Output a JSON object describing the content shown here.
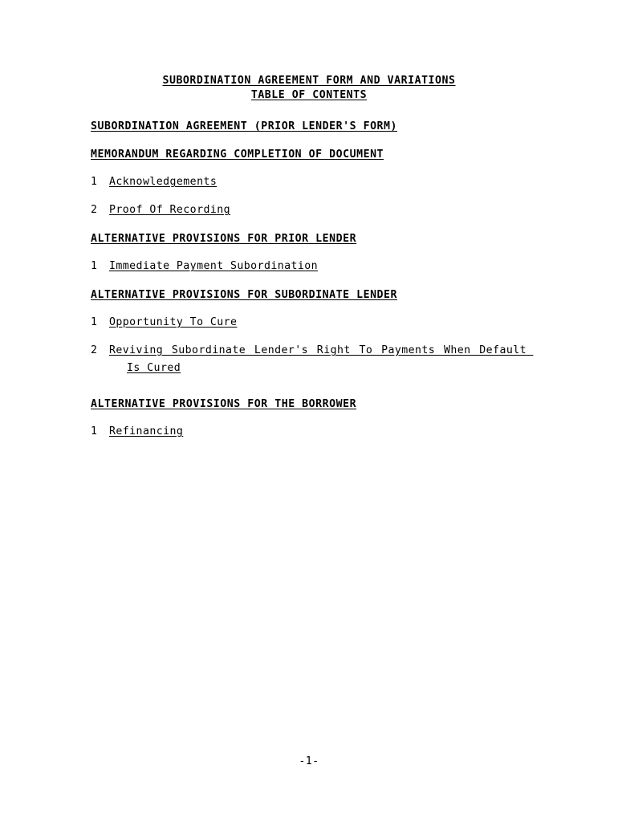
{
  "document": {
    "title_lines": [
      "SUBORDINATION AGREEMENT FORM AND VARIATIONS",
      "TABLE OF CONTENTS"
    ],
    "footer": "-1-"
  },
  "toc": {
    "sections": [
      {
        "heading": "SUBORDINATION AGREEMENT (PRIOR LENDER'S FORM)",
        "items": []
      },
      {
        "heading": "MEMORANDUM REGARDING COMPLETION OF DOCUMENT",
        "items": [
          {
            "number": "1",
            "label": "Acknowledgements"
          },
          {
            "number": "2",
            "label": "Proof Of Recording"
          }
        ]
      },
      {
        "heading": "ALTERNATIVE PROVISIONS FOR PRIOR LENDER",
        "items": [
          {
            "number": "1",
            "label": "Immediate Payment Subordination"
          }
        ]
      },
      {
        "heading": "ALTERNATIVE PROVISIONS FOR SUBORDINATE LENDER",
        "items": [
          {
            "number": "1",
            "label": "Opportunity To Cure"
          },
          {
            "number": "2",
            "label": "Reviving Subordinate Lender's Right To Payments When Default Is Cured"
          }
        ]
      },
      {
        "heading": "ALTERNATIVE PROVISIONS FOR THE BORROWER",
        "items": [
          {
            "number": "1",
            "label": "Refinancing"
          }
        ]
      }
    ]
  }
}
